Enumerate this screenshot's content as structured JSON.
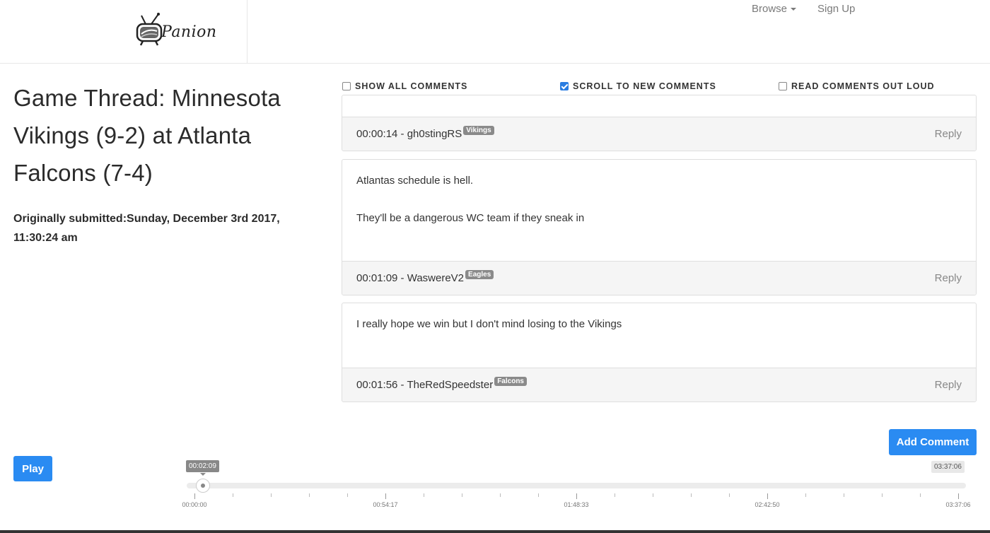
{
  "nav": {
    "brand_text": "Panion",
    "browse_label": "Browse",
    "signup_label": "Sign Up"
  },
  "thread": {
    "title": "Game Thread: Minnesota Vikings (9-2) at Atlanta Falcons (7-4)",
    "submitted": "Originally submitted:Sunday, December 3rd 2017, 11:30:24 am"
  },
  "options": [
    {
      "label": "SHOW ALL COMMENTS",
      "checked": false
    },
    {
      "label": "SCROLL TO NEW COMMENTS",
      "checked": true
    },
    {
      "label": "READ COMMENTS OUT LOUD",
      "checked": false
    }
  ],
  "comments": [
    {
      "lines": [],
      "meta": "00:00:14 - gh0stingRS",
      "team": "Vikings",
      "reply": "Reply"
    },
    {
      "lines": [
        "Atlantas schedule is hell.",
        "They'll be a dangerous WC team if they sneak in"
      ],
      "meta": "00:01:09 - WaswereV2",
      "team": "Eagles",
      "reply": "Reply"
    },
    {
      "lines": [
        "I really hope we win but I don't mind losing to the Vikings"
      ],
      "meta": "00:01:56 - TheRedSpeedster",
      "team": "Falcons",
      "reply": "Reply"
    }
  ],
  "actions": {
    "add_comment": "Add Comment",
    "play": "Play"
  },
  "player": {
    "current_time": "00:02:09",
    "total_time": "03:37:06",
    "progress_fraction": 0.0099,
    "tick_labels": [
      "00:00:00",
      "00:54:17",
      "01:48:33",
      "02:42:50",
      "03:37:06"
    ]
  },
  "colors": {
    "accent": "#2a8bf2",
    "tag_bg": "#8a8a8a"
  }
}
